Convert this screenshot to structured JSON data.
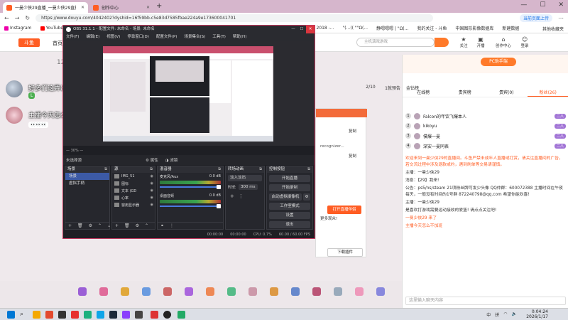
{
  "browser": {
    "tabs": [
      {
        "label": "一曼少侠29直播_一曼少侠29直播",
        "color": "#ff5d23"
      },
      {
        "label": "创作中心",
        "color": "#ff5d23"
      }
    ],
    "url": "https://www.douyu.com/4042402?dyshid=16f59bb-c5e83d7585fbae224a9e173600041701",
    "extension_button": "当前页面上传",
    "bookmarks": [
      "Instagram",
      "YouTube",
      "Tales Inside 2018 -...",
      "\"(...(( \"\"Ω(...",
      "静嗯嗯嗯 | \"Ω(...",
      "我的关注 - 斗鱼",
      "中国图形影像数据库",
      "新建数据"
    ],
    "bookmarks_right": "其他收藏夹"
  },
  "site": {
    "logo": "斗鱼",
    "nav_home": "首页",
    "search_placeholder": "主机演戏游戏",
    "header_icons": [
      {
        "icon": "★",
        "label": "关注"
      },
      {
        "icon": "▣",
        "label": "开播"
      },
      {
        "icon": "⌂",
        "label": "创作中心"
      },
      {
        "icon": "☺",
        "label": "登录"
      }
    ]
  },
  "overlay": {
    "stat_number": "12",
    "danmaku": [
      {
        "text": "好多们这弄出",
        "bubble": "L"
      },
      {
        "text": "主播今天怎么不加班",
        "bubble": "👀👀👀"
      }
    ]
  },
  "right_panel": {
    "badge": "PC助手端",
    "stats": [
      "2/10",
      "1就预告",
      "金钻榜"
    ],
    "tabs": [
      "在线榜",
      "贵宾榜",
      "贵宾(0)",
      "粉丝(26)"
    ],
    "rank_rows": [
      {
        "rank": "1",
        "name": "Falcon的年饮飞爆本人",
        "badge": "二八"
      },
      {
        "rank": "2",
        "name": "kikoyu",
        "badge": "二八"
      },
      {
        "rank": "3",
        "name": "僕爆一曼",
        "badge": "二八"
      },
      {
        "rank": "4",
        "name": "深安一曼同表",
        "badge": "二八"
      }
    ],
    "chat": [
      {
        "text": "欢迎来到一曼少侠29的直播间。斗鱼严禁未成年人直播或打赏，请关注直播间的广告，若交流过程中涉及退款或约，遇到刷单等交易请谨慎。",
        "highlight": true
      },
      {
        "text": "主播：一曼少侠29",
        "highlight": false
      },
      {
        "text": "消息：【29】我来!",
        "highlight": false
      },
      {
        "text": "公告：ps5/ns/steam 21项粉丝牌可发少头像 QQ仲群：600072388 主播时间在午夜每天，一般没有时间的1号群 872240798@qq.com 希望你能欢喜!",
        "highlight": false
      },
      {
        "text": "主播：一曼少侠29",
        "highlight": false
      },
      {
        "text": "是喜欢打游戏需要运动接收的爱篮! 请点点关注吧!",
        "highlight": false
      },
      {
        "text": "一曼少侠29 来了",
        "highlight": true
      },
      {
        "text": "主播今天怎么不加班",
        "highlight": true
      }
    ],
    "chat_placeholder": "这里输入聊天内容"
  },
  "bg_dialog": {
    "copy_labels": [
      "复制",
      "复制"
    ],
    "key_hint": "recognizer...",
    "link_text": "更多观众!",
    "open_button": "打开直播伴侣",
    "download_button": "下载插件"
  },
  "obs": {
    "title": "OBS 31.1.1 - 配置文件: 未命名 - 场景: 未命名",
    "menu": [
      "文件(F)",
      "编辑(E)",
      "视图(V)",
      "停靠窗口(D)",
      "配置文件(P)",
      "场景集合(S)",
      "工具(T)",
      "帮助(H)"
    ],
    "zoom": "— 30% —",
    "no_source": "未选择源",
    "props_label": "⚙ 属性",
    "filters_label": "◑ 滤镜",
    "docks": {
      "scenes": {
        "title": "场景",
        "items": [
          "场景",
          "虚拟手柄"
        ],
        "selected": 0
      },
      "sources": {
        "title": "源",
        "items": [
          "IMG_51",
          "图标",
          "文本 (GD",
          "心率",
          "窗用显示器"
        ]
      },
      "mixer": {
        "title": "混音器",
        "channels": [
          {
            "name": "麦克风/Aux",
            "db": "0.0 dB",
            "level": 0.78
          },
          {
            "name": "桌面音频",
            "db": "0.0 dB",
            "level": 0.62
          }
        ]
      },
      "transitions": {
        "title": "转场动画",
        "type": "淡入淡出",
        "duration_label": "时长",
        "duration": "300 ms"
      },
      "controls": {
        "title": "控制按钮",
        "buttons": [
          "开始直播",
          "开始录制",
          "启动虚拟摄像机",
          "工作室模式",
          "设置",
          "退出"
        ]
      }
    },
    "status": {
      "net": "00:00:00",
      "rec": "00:00:00",
      "cpu": "CPU: 0.7%",
      "fps": "60.00 / 60.00 FPS"
    }
  },
  "taskbar": {
    "time": "0:04:24",
    "date": "2026/1/17",
    "tray": [
      "中",
      "拼"
    ],
    "app_colors": [
      "#0078d4",
      "#f4a800",
      "#e34a2f",
      "#333333",
      "#e72f2f",
      "#1bb07e",
      "#0ea5e9",
      "#d33",
      "#8a3ffc",
      "#444"
    ]
  }
}
